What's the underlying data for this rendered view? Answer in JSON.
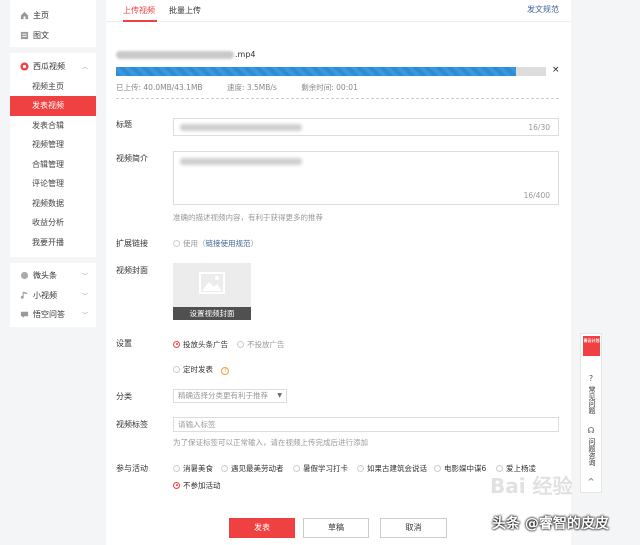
{
  "sidebar": {
    "home": "主页",
    "articles": "图文",
    "video_section": "西瓜视频",
    "video_subitems": [
      "视频主页",
      "发表视频",
      "发表合辑",
      "视频管理",
      "合辑管理",
      "评论管理",
      "视频数据",
      "收益分析",
      "我要开播"
    ],
    "micro": "微头条",
    "short_video": "小视频",
    "qa": "悟空问答"
  },
  "tabs": {
    "upload": "上传视频",
    "batch": "批量上传",
    "rules": "发文规范"
  },
  "upload": {
    "file_ext": ".mp4",
    "progress": 0.93,
    "uploaded": "已上传: 40.0MB/43.1MB",
    "speed": "速度: 3.5MB/s",
    "remaining": "剩余时间: 00:01",
    "close_glyph": "×"
  },
  "form": {
    "title_label": "标题",
    "title_counter": "16/30",
    "desc_label": "视频简介",
    "desc_counter": "16/400",
    "desc_hint": "准确的描述视频内容，有利于获得更多的推荐",
    "ext_label": "扩展链接",
    "ext_use": "使用",
    "ext_open": "（",
    "ext_link": "链接使用规范",
    "ext_close": "）",
    "cover_label": "视频封面",
    "cover_button": "设置视频封面",
    "settings_label": "设置",
    "ad_on": "投放头条广告",
    "ad_off": "不投放广告",
    "schedule": "定时发表",
    "category_label": "分类",
    "category_placeholder": "精确选择分类更有利于推荐",
    "tags_label": "视频标签",
    "tags_placeholder": "请输入标签",
    "tags_hint": "为了保证标签可以正常输入，请在视频上传完成后进行添加",
    "activity_label": "参与活动",
    "activities": [
      "消暑美食",
      "遇见最美劳动者",
      "暑假学习打卡",
      "如果古建筑会说话",
      "电影媒中谍6",
      "爱上杨凌"
    ],
    "no_activity": "不参加活动"
  },
  "buttons": {
    "publish": "发表",
    "draft": "草稿",
    "cancel": "取消"
  },
  "float": {
    "badge": "青云计划",
    "faq": "常见问题",
    "feedback": "问题咨询",
    "up": "^"
  },
  "watermarks": {
    "baidu": "Bai  经验",
    "author": "头条 @睿智的皮皮"
  },
  "colors": {
    "accent": "#f04142",
    "link": "#406599",
    "progress": "#2d8cd6"
  }
}
